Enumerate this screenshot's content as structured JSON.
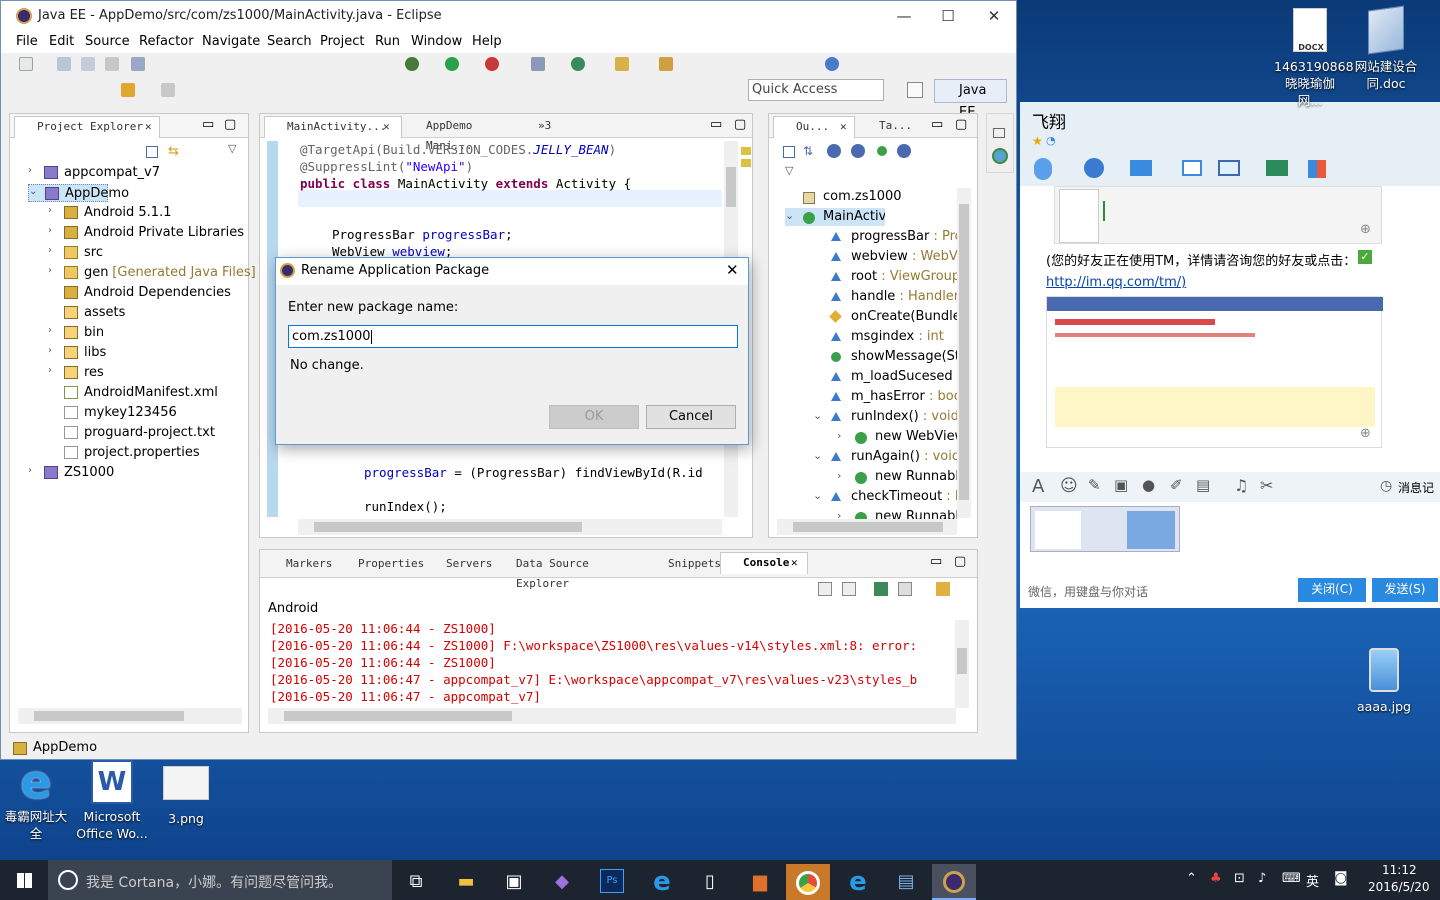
{
  "eclipse": {
    "title": "Java EE - AppDemo/src/com/zs1000/MainActivity.java - Eclipse",
    "menu": [
      "File",
      "Edit",
      "Source",
      "Refactor",
      "Navigate",
      "Search",
      "Project",
      "Run",
      "Window",
      "Help"
    ],
    "quick_access": "Quick Access",
    "perspective": "Java EE",
    "project_explorer": {
      "tab": "Project Explorer",
      "items": [
        {
          "label": "appcompat_v7"
        },
        {
          "label": "AppDemo"
        },
        {
          "label": "Android 5.1.1"
        },
        {
          "label": "Android Private Libraries"
        },
        {
          "label": "src"
        },
        {
          "label": "gen",
          "suffix": "[Generated Java Files]"
        },
        {
          "label": "Android Dependencies"
        },
        {
          "label": "assets"
        },
        {
          "label": "bin"
        },
        {
          "label": "libs"
        },
        {
          "label": "res"
        },
        {
          "label": "AndroidManifest.xml"
        },
        {
          "label": "mykey123456"
        },
        {
          "label": "proguard-project.txt"
        },
        {
          "label": "project.properties"
        },
        {
          "label": "ZS1000"
        }
      ]
    },
    "editor": {
      "tabs": [
        "MainActivity...",
        "AppDemo Mani...",
        "»3"
      ],
      "lines": [
        "@TargetApi(Build.VERSION_CODES.JELLY_BEAN)",
        "@SuppressLint(\"NewApi\")",
        "public class MainActivity extends Activity {",
        "ProgressBar progressBar;",
        "WebView webview;",
        "progressBar = (ProgressBar) findViewById(R.id",
        "runIndex();"
      ]
    },
    "outline": {
      "tabs": [
        "Ou...",
        "Ta..."
      ],
      "items": [
        {
          "name": "com.zs1000",
          "type": ""
        },
        {
          "name": "MainActivity",
          "type": ""
        },
        {
          "name": "progressBar",
          "type": " : Pro"
        },
        {
          "name": "webview",
          "type": " : WebVi"
        },
        {
          "name": "root",
          "type": " : ViewGroup"
        },
        {
          "name": "handle",
          "type": " : Handler"
        },
        {
          "name": "onCreate(Bundle)",
          "type": ""
        },
        {
          "name": "msgindex",
          "type": " : int"
        },
        {
          "name": "showMessage(St",
          "type": ""
        },
        {
          "name": "m_loadSucesed",
          "type": ""
        },
        {
          "name": "m_hasError",
          "type": " : boo"
        },
        {
          "name": "runIndex()",
          "type": " : void"
        },
        {
          "name": "new WebView",
          "type": ""
        },
        {
          "name": "runAgain()",
          "type": " : void"
        },
        {
          "name": "new Runnabl",
          "type": ""
        },
        {
          "name": "checkTimeout",
          "type": " : R"
        },
        {
          "name": "new Runnabl",
          "type": ""
        }
      ]
    },
    "bottom_tabs": [
      "Markers",
      "Properties",
      "Servers",
      "Data Source Explorer",
      "Snippets",
      "Console"
    ],
    "console": {
      "header": "Android",
      "lines": [
        "[2016-05-20 11:06:44 - ZS1000]",
        "[2016-05-20 11:06:44 - ZS1000] F:\\workspace\\ZS1000\\res\\values-v14\\styles.xml:8: error:",
        "[2016-05-20 11:06:44 - ZS1000]",
        "[2016-05-20 11:06:47 - appcompat_v7] E:\\workspace\\appcompat_v7\\res\\values-v23\\styles_b",
        "[2016-05-20 11:06:47 - appcompat_v7]"
      ]
    },
    "status": "AppDemo"
  },
  "dialog": {
    "title": "Rename Application Package",
    "prompt": "Enter new package name:",
    "value": "com.zs1000",
    "message": "No change.",
    "ok": "OK",
    "cancel": "Cancel"
  },
  "desktop": {
    "right_icons": [
      {
        "label": "1463190868\n晓晓瑜伽网..."
      },
      {
        "label": "网站建设合\n同.doc"
      },
      {
        "label": "aaaa.jpg"
      }
    ],
    "docx_badge": "DOCX",
    "bottom_icons": [
      {
        "label": "毒霸网址大\n全"
      },
      {
        "label": "Microsoft\nOffice Wo..."
      },
      {
        "label": "3.png"
      }
    ]
  },
  "chat": {
    "name": "飞翔",
    "notice": "(您的好友正在使用TM，详情请咨询您的好友或点击：",
    "link": "http://im.qq.com/tm/)",
    "history": "消息记",
    "placeholder": "微信，用键盘与你对话",
    "close": "关闭(C)",
    "send": "发送(S)"
  },
  "taskbar": {
    "search": "我是 Cortana，小娜。有问题尽管问我。",
    "ime": "英",
    "time": "11:12",
    "date": "2016/5/20"
  }
}
